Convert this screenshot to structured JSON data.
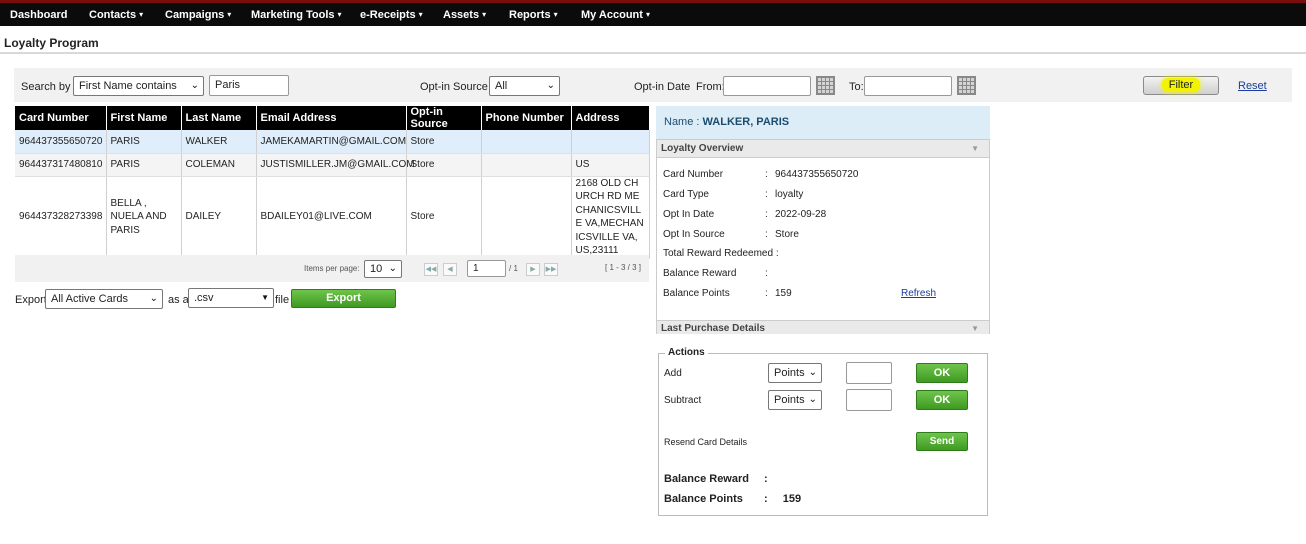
{
  "nav": {
    "items": [
      "Dashboard",
      "Contacts",
      "Campaigns",
      "Marketing Tools",
      "e-Receipts",
      "Assets",
      "Reports",
      "My Account"
    ],
    "caret": "▾"
  },
  "page": {
    "title": "Loyalty Program"
  },
  "filters": {
    "search_by_label": "Search by :",
    "search_by_value": "First Name contains",
    "search_text": "Paris",
    "optin_source_label": "Opt-in Source :",
    "optin_source_value": "All",
    "optin_date_label": "Opt-in Date",
    "from_label": "From:",
    "to_label": "To:",
    "filter_label": "Filter",
    "reset_label": "Reset"
  },
  "table": {
    "headers": [
      "Card Number",
      "First Name",
      "Last Name",
      "Email Address",
      "Opt-in Source",
      "Phone Number",
      "Address"
    ],
    "rows": [
      [
        "964437355650720",
        "PARIS",
        "WALKER",
        "JAMEKAMARTIN@GMAIL.COM",
        "Store",
        "",
        ""
      ],
      [
        "964437317480810",
        "PARIS",
        "COLEMAN",
        "JUSTISMILLER.JM@GMAIL.COM",
        "Store",
        "",
        "US"
      ],
      [
        "964437328273398",
        "BELLA , NUELA AND PARIS",
        "DAILEY",
        "BDAILEY01@LIVE.COM",
        "Store",
        "",
        "2168 OLD CHURCH RD MECHANICSVILLE VA,MECHANICSVILLE VA,US,23111"
      ]
    ]
  },
  "pager": {
    "items_per_page_label": "Items per page:",
    "items_per_page_value": "10",
    "page_value": "1",
    "page_total": "/ 1",
    "range": "[ 1 - 3 / 3 ]"
  },
  "export": {
    "label": "Export",
    "cards_value": "All Active Cards",
    "as_a_label": "as a",
    "format_value": ".csv",
    "file_label": "file",
    "button_label": "Export"
  },
  "detail": {
    "name_label": "Name :",
    "name_value": "WALKER, PARIS",
    "overview_title": "Loyalty Overview",
    "rows": [
      {
        "key": "Card Number",
        "value": "964437355650720"
      },
      {
        "key": "Card Type",
        "value": "loyalty"
      },
      {
        "key": "Opt In Date",
        "value": "2022-09-28"
      },
      {
        "key": "Opt In Source",
        "value": "Store"
      },
      {
        "key": "Total Reward Redeemed :",
        "value": ""
      },
      {
        "key": "Balance Reward",
        "value": ""
      },
      {
        "key": "Balance Points",
        "value": "159"
      }
    ],
    "refresh_label": "Refresh",
    "last_purchase_title": "Last Purchase Details"
  },
  "actions": {
    "legend": "Actions",
    "add_label": "Add",
    "subtract_label": "Subtract",
    "unit_value": "Points",
    "ok_label": "OK",
    "resend_label": "Resend Card Details",
    "send_label": "Send",
    "balance_reward_label": "Balance Reward",
    "balance_reward_value": "",
    "balance_points_label": "Balance Points",
    "balance_points_value": "159"
  },
  "colors": {
    "topbar": "#0b0b0b",
    "accent_red": "#7a0d0d",
    "header_black": "#000000",
    "selected_row": "#dfeefa",
    "green_button": "#4fa82d",
    "highlight": "#f3f200"
  }
}
